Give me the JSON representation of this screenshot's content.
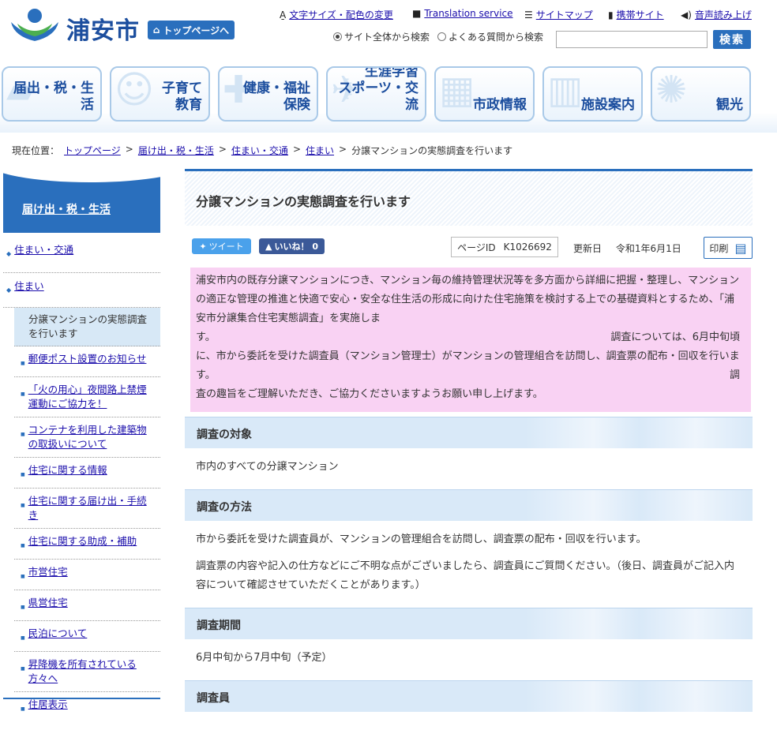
{
  "header": {
    "city_name": "浦安市",
    "top_page_button": "トップページへ",
    "util_links": [
      "文字サイズ・配色の変更",
      "Translation service",
      "サイトマップ",
      "携帯サイト",
      "音声読み上げ"
    ],
    "search_scope_all": "サイト全体から検索",
    "search_scope_faq": "よくある質問から検索",
    "search_input_value": "",
    "search_button": "検索"
  },
  "nav": {
    "items": [
      {
        "label": "届出・税・生活"
      },
      {
        "label": "子育て\n教育"
      },
      {
        "label": "健康・福祉\n保険"
      },
      {
        "label": "生涯学習\nスポーツ・交流"
      },
      {
        "label": "市政情報"
      },
      {
        "label": "施設案内"
      },
      {
        "label": "観光"
      }
    ]
  },
  "breadcrumb": {
    "prefix": "現在位置：",
    "links": [
      "トップページ",
      "届け出・税・生活",
      "住まい・交通",
      "住まい"
    ],
    "separator": ">",
    "current": "分譲マンションの実態調査を行います"
  },
  "sidebar": {
    "title": "届け出・税・生活",
    "level1": [
      "住まい・交通",
      "住まい"
    ],
    "current": "分譲マンションの実態調査を行います",
    "items": [
      "郵便ポスト設置のお知らせ",
      "「火の用心」夜間路上禁煙運動にご協力を！",
      "コンテナを利用した建築物の取扱いについて",
      "住宅に関する情報",
      "住宅に関する届け出・手続き",
      "住宅に関する助成・補助",
      "市営住宅",
      "県営住宅",
      "民泊について",
      "昇降機を所有されている方々へ",
      "住居表示"
    ]
  },
  "content": {
    "title": "分譲マンションの実態調査を行います",
    "tweet": "ツイート",
    "like": "いいね！ 0",
    "page_id_label": "ページID",
    "page_id": "K1026692",
    "updated_label": "更新日",
    "updated_date": "令和1年6月1日",
    "print": "印刷",
    "intro_1": "浦安市内の既存分譲マンションにつき、マンション毎の維持管理状況等を多方面から詳細に把握・整理し、マンションの適正な管理の推進と快適で安心・安全な住生活の形成に向けた住宅施策を検討する上での基礎資料とするため、「浦安市分譲集合住宅実態調査」を実施しま",
    "intro_2a": "す。",
    "intro_2b": "調査については、6月中旬頃",
    "intro_3": "に、市から委託を受けた調査員（マンション管理士）がマンションの管理組合を訪問し、調査票の配布・回収を行いま",
    "intro_4a": "す。",
    "intro_4b": "調",
    "intro_5": "査の趣旨をご理解いただき、ご協力くださいますようお願い申し上げます。",
    "sections": [
      {
        "heading": "調査の対象",
        "paragraphs": [
          "市内のすべての分譲マンション"
        ]
      },
      {
        "heading": "調査の方法",
        "paragraphs": [
          "市から委託を受けた調査員が、マンションの管理組合を訪問し、調査票の配布・回収を行います。",
          "調査票の内容や記入の仕方などにご不明な点がございましたら、調査員にご質問ください。（後日、調査員がご記入内容について確認させていただくことがあります。）"
        ]
      },
      {
        "heading": "調査期間",
        "paragraphs": [
          "6月中旬から7月中旬（予定）"
        ]
      },
      {
        "heading": "調査員",
        "paragraphs": []
      }
    ]
  }
}
